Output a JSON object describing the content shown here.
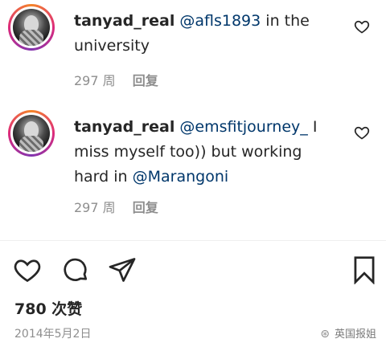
{
  "comments": [
    {
      "username": "tanyad_real",
      "text_parts": [
        {
          "text": "@afls1893",
          "type": "mention"
        },
        {
          "text": " in the university",
          "type": "plain"
        }
      ],
      "time": "297 周",
      "reply_label": "回复"
    },
    {
      "username": "tanyad_real",
      "text_parts": [
        {
          "text": "@emsfitjourney_",
          "type": "mention"
        },
        {
          "text": " I miss myself too)) but working hard in ",
          "type": "plain"
        },
        {
          "text": "@Marangoni",
          "type": "mention"
        }
      ],
      "time": "297 周",
      "reply_label": "回复"
    }
  ],
  "post": {
    "likes": "780 次赞",
    "date": "2014年5月2日"
  },
  "watermark": {
    "text": "英国报姐"
  },
  "icons": {
    "comment_like": "heart-outline-icon",
    "like": "heart-outline-icon",
    "comment": "speech-bubble-icon",
    "share": "paper-plane-icon",
    "save": "bookmark-icon"
  },
  "colors": {
    "mention": "#00376b",
    "meta": "#8e8e8e",
    "text": "#262626"
  }
}
